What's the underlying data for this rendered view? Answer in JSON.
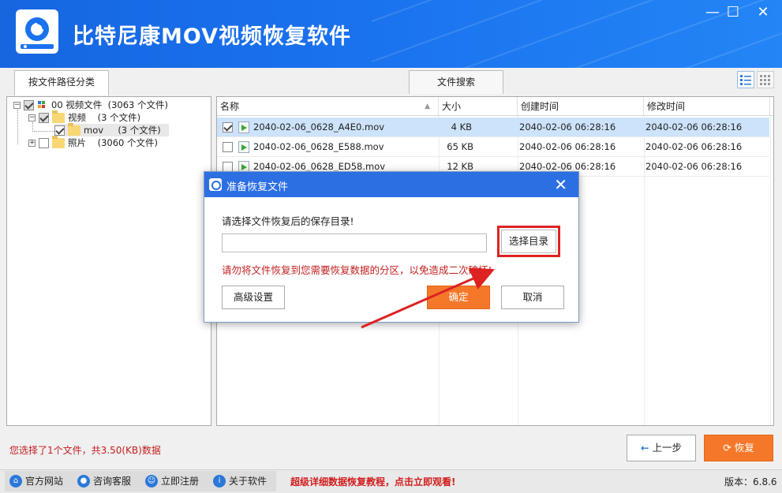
{
  "app": {
    "title": "比特尼康MOV视频恢复软件",
    "window_controls": {
      "minimize": "—",
      "maximize": "☐",
      "close": "✕"
    },
    "brand_color": "#1a72ee"
  },
  "tabs": [
    {
      "label": "按文件路径分类",
      "active": true
    },
    {
      "label": "文件搜索",
      "active": false
    }
  ],
  "view_toggle": [
    "list-view-icon",
    "grid-view-icon"
  ],
  "tree": {
    "items": [
      {
        "label": "00 视频文件  (3063 个文件)",
        "expander": "−",
        "checked": "partial"
      },
      {
        "label": "视频    (3 个文件)",
        "expander": "−",
        "checked": "partial"
      },
      {
        "label": "mov     (3 个文件)",
        "expander": "",
        "checked": "checked"
      },
      {
        "label": "照片    (3060 个文件)",
        "expander": "+",
        "checked": "unchecked"
      }
    ]
  },
  "table": {
    "columns": [
      "名称",
      "大小",
      "创建时间",
      "修改时间"
    ],
    "rows": [
      {
        "name": "2040-02-06_0628_A4E0.mov",
        "size": "4 KB",
        "created": "2040-02-06  06:28:16",
        "modified": "2040-02-06  06:28:16",
        "checked": true,
        "selected": true
      },
      {
        "name": "2040-02-06_0628_E588.mov",
        "size": "65 KB",
        "created": "2040-02-06  06:28:16",
        "modified": "2040-02-06  06:28:16",
        "checked": false,
        "selected": false
      },
      {
        "name": "2040-02-06_0628_ED58.mov",
        "size": "12 KB",
        "created": "2040-02-06  06:28:16",
        "modified": "2040-02-06  06:28:16",
        "checked": false,
        "selected": false
      }
    ]
  },
  "status": {
    "selection_text": "您选择了1个文件，共3.50(KB)数据"
  },
  "nav_buttons": {
    "prev_label": "上一步",
    "recover_label": "恢复"
  },
  "footer": {
    "links": [
      {
        "label": "官方网站",
        "icon": "home-icon"
      },
      {
        "label": "咨询客服",
        "icon": "chat-icon"
      },
      {
        "label": "立即注册",
        "icon": "user-icon"
      },
      {
        "label": "关于软件",
        "icon": "info-icon"
      }
    ],
    "promo": "超级详细数据恢复教程，点击立即观看!",
    "version": "版本：6.8.6"
  },
  "dialog": {
    "title": "准备恢复文件",
    "prompt": "请选择文件恢复后的保存目录!",
    "path_value": "",
    "choose_dir_label": "选择目录",
    "warning": "请勿将文件恢复到您需要恢复数据的分区，以免造成二次破坏!",
    "advanced_label": "高级设置",
    "ok_label": "确定",
    "cancel_label": "取消",
    "ok_color": "#f5782a",
    "highlight_color": "#dd2222"
  }
}
